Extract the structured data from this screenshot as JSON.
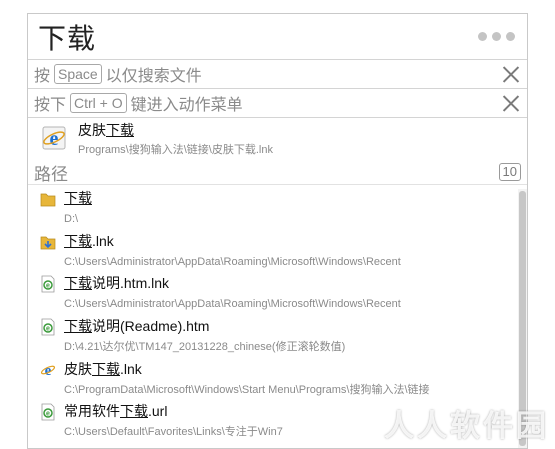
{
  "window": {
    "query": "下载"
  },
  "hint1": {
    "prefix": "按",
    "key": "Space",
    "suffix": "以仅搜索文件"
  },
  "hint2": {
    "prefix": "按下",
    "key": "Ctrl + O",
    "suffix": "键进入动作菜单"
  },
  "top_result": {
    "name_pre": "皮肤",
    "name_match": "下载",
    "name_post": "",
    "path": "Programs\\搜狗输入法\\链接\\皮肤下载.lnk",
    "icon": "ie-icon"
  },
  "section": {
    "label": "路径",
    "count": "10"
  },
  "items": [
    {
      "pre": "",
      "match": "下载",
      "post": "",
      "path": "D:\\",
      "icon": "folder-icon"
    },
    {
      "pre": "",
      "match": "下载",
      "post": ".lnk",
      "path": "C:\\Users\\Administrator\\AppData\\Roaming\\Microsoft\\Windows\\Recent",
      "icon": "folder-shortcut-icon"
    },
    {
      "pre": "",
      "match": "下载",
      "post": "说明.htm.lnk",
      "path": "C:\\Users\\Administrator\\AppData\\Roaming\\Microsoft\\Windows\\Recent",
      "icon": "html-file-icon"
    },
    {
      "pre": "",
      "match": "下载",
      "post": "说明(Readme).htm",
      "path": "D:\\4.21\\达尔优\\TM147_20131228_chinese(修正滚轮数值)",
      "icon": "html-file-icon"
    },
    {
      "pre": "皮肤",
      "match": "下载",
      "post": ".lnk",
      "path": "C:\\ProgramData\\Microsoft\\Windows\\Start Menu\\Programs\\搜狗输入法\\链接",
      "icon": "ie-icon"
    },
    {
      "pre": "常用软件",
      "match": "下载",
      "post": ".url",
      "path": "C:\\Users\\Default\\Favorites\\Links\\专注于Win7",
      "icon": "html-file-icon"
    }
  ],
  "watermark": "人人软件园",
  "colors": {
    "border": "#c9c9c9",
    "hint": "#8a8a8a",
    "ie_blue": "#1e6fd0",
    "folder": "#e7b63a"
  }
}
